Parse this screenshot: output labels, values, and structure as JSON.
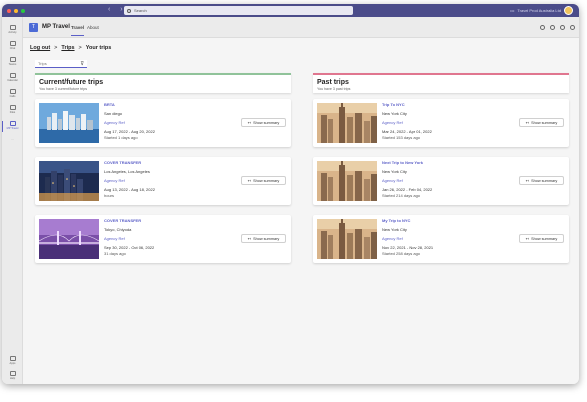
{
  "titlebar": {
    "search_placeholder": "Search",
    "user_name": "Travel Prod Australia Ltd"
  },
  "rail": {
    "items": [
      {
        "label": "Activity"
      },
      {
        "label": "Chat"
      },
      {
        "label": "Teams"
      },
      {
        "label": "Calendar"
      },
      {
        "label": "Calls"
      },
      {
        "label": "Files"
      },
      {
        "label": "MP Travel"
      },
      {
        "label": "..."
      }
    ],
    "bottom": [
      {
        "label": "Apps"
      },
      {
        "label": "Help"
      }
    ]
  },
  "app": {
    "name": "MP Travel",
    "logo_letter": "T",
    "tabs": [
      {
        "label": "Travel"
      },
      {
        "label": "About"
      }
    ]
  },
  "breadcrumb": {
    "logout": "Log out",
    "sep1": ">",
    "trips": "Trips",
    "sep2": ">",
    "current": "Your trips"
  },
  "filter": {
    "value": "Trips"
  },
  "current": {
    "title": "Current/future trips",
    "subtitle": "You have 3 current/future trips",
    "trips": [
      {
        "title": "BRTA",
        "city": "San diego",
        "agency": "Agency Ref",
        "dates": "Aug 17, 2022 - Aug 20, 2022",
        "ago": "Started 1 days ago",
        "button": "Show summary"
      },
      {
        "title": "COVER TRANSFER",
        "city": "Los Angeles, Los Angeles",
        "agency": "Agency Ref",
        "dates": "Aug 13, 2022 - Aug 18, 2022",
        "ago": "hours",
        "button": "Show summary"
      },
      {
        "title": "COVER TRANSFER",
        "city": "Tokyo, Chiyoda",
        "agency": "Agency Ref",
        "dates": "Sep 30, 2022 - Oct 06, 2022",
        "ago": "31 days ago",
        "button": "Show summary"
      }
    ]
  },
  "past": {
    "title": "Past trips",
    "subtitle": "You have 3 past trips",
    "trips": [
      {
        "title": "Trip To NYC",
        "city": "New York City",
        "agency": "Agency Ref",
        "dates": "Mar 24, 2022 - Apr 01, 2022",
        "ago": "Started 153 days ago",
        "button": "Show summary"
      },
      {
        "title": "Next Trip to New York",
        "city": "New York City",
        "agency": "Agency Ref",
        "dates": "Jan 26, 2022 - Feb 04, 2022",
        "ago": "Started 214 days ago",
        "button": "Show summary"
      },
      {
        "title": "My Trip to NYC",
        "city": "New York City",
        "agency": "Agency Ref",
        "dates": "Nov 22, 2021 - Nov 28, 2021",
        "ago": "Started 258 days ago",
        "button": "Show summary"
      }
    ]
  },
  "colors": {
    "brand": "#5b5fc7",
    "titlebar": "#4b4c8a",
    "current_accent": "#90c39a",
    "past_accent": "#e0768f"
  }
}
